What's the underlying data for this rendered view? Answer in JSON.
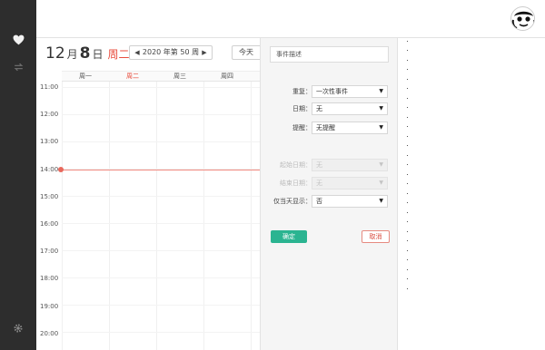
{
  "sidebar": {
    "icons": [
      "heart-icon",
      "sync-icon",
      "settings-icon"
    ]
  },
  "header": {
    "date": {
      "month": "12",
      "month_unit": "月",
      "day": "8",
      "day_unit": "日",
      "weekday": "周二"
    },
    "week_nav": {
      "label": "2020 年第 50 周",
      "prev": "◀",
      "next": "▶"
    },
    "today_label": "今天"
  },
  "calendar": {
    "day_headers": [
      "周一",
      "周二",
      "周三",
      "周四"
    ],
    "highlight_day": 1,
    "time_labels": [
      "11:00",
      "12:00",
      "13:00",
      "14:00",
      "15:00",
      "16:00",
      "17:00",
      "18:00",
      "19:00",
      "20:00"
    ],
    "now_time": "14:00"
  },
  "form": {
    "description_placeholder": "事件描述",
    "repeat": {
      "label": "重复：",
      "value": "一次性事件"
    },
    "date": {
      "label": "日期：",
      "value": "无"
    },
    "reminder": {
      "label": "提醒：",
      "value": "无提醒"
    },
    "start_date": {
      "label": "起始日期：",
      "value": "无"
    },
    "end_date": {
      "label": "结束日期：",
      "value": "无"
    },
    "show_only_that_day": {
      "label": "仅当天显示：",
      "value": "否"
    },
    "confirm_label": "确定",
    "cancel_label": "取消"
  },
  "colors": {
    "accent_red": "#e84c3d",
    "confirm_green": "#2bb491",
    "sidebar_bg": "#2d2d2d"
  }
}
